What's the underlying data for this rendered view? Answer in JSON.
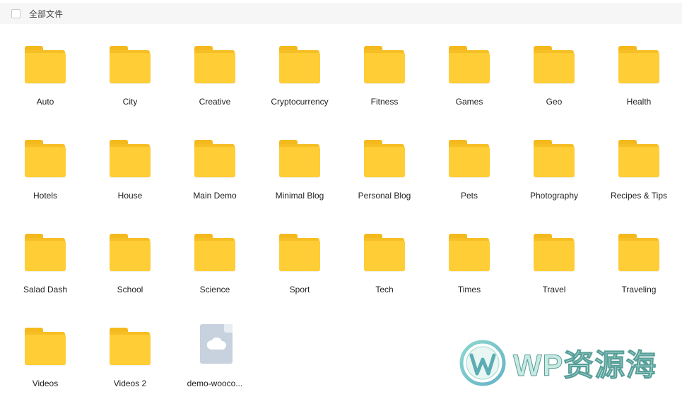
{
  "header": {
    "select_all_label": "全部文件"
  },
  "items": [
    {
      "type": "folder",
      "name": "Auto"
    },
    {
      "type": "folder",
      "name": "City"
    },
    {
      "type": "folder",
      "name": "Creative"
    },
    {
      "type": "folder",
      "name": "Cryptocurrency"
    },
    {
      "type": "folder",
      "name": "Fitness"
    },
    {
      "type": "folder",
      "name": "Games"
    },
    {
      "type": "folder",
      "name": "Geo"
    },
    {
      "type": "folder",
      "name": "Health"
    },
    {
      "type": "folder",
      "name": "Hotels"
    },
    {
      "type": "folder",
      "name": "House"
    },
    {
      "type": "folder",
      "name": "Main Demo"
    },
    {
      "type": "folder",
      "name": "Minimal Blog"
    },
    {
      "type": "folder",
      "name": "Personal Blog"
    },
    {
      "type": "folder",
      "name": "Pets"
    },
    {
      "type": "folder",
      "name": "Photography"
    },
    {
      "type": "folder",
      "name": "Recipes & Tips"
    },
    {
      "type": "folder",
      "name": "Salad Dash"
    },
    {
      "type": "folder",
      "name": "School"
    },
    {
      "type": "folder",
      "name": "Science"
    },
    {
      "type": "folder",
      "name": "Sport"
    },
    {
      "type": "folder",
      "name": "Tech"
    },
    {
      "type": "folder",
      "name": "Times"
    },
    {
      "type": "folder",
      "name": "Travel"
    },
    {
      "type": "folder",
      "name": "Traveling"
    },
    {
      "type": "folder",
      "name": "Videos"
    },
    {
      "type": "folder",
      "name": "Videos 2"
    },
    {
      "type": "file",
      "name": "demo-wooco..."
    }
  ],
  "watermark": {
    "text": "WP资源海",
    "logo_icon": "wordpress-logo"
  },
  "colors": {
    "folder_front": "#ffcd36",
    "folder_back": "#f6bf25",
    "file_icon": "#c7d2de",
    "header_bg": "#f6f6f7",
    "watermark_fill": "#bfe6df",
    "watermark_stroke": "#3b8f88"
  }
}
